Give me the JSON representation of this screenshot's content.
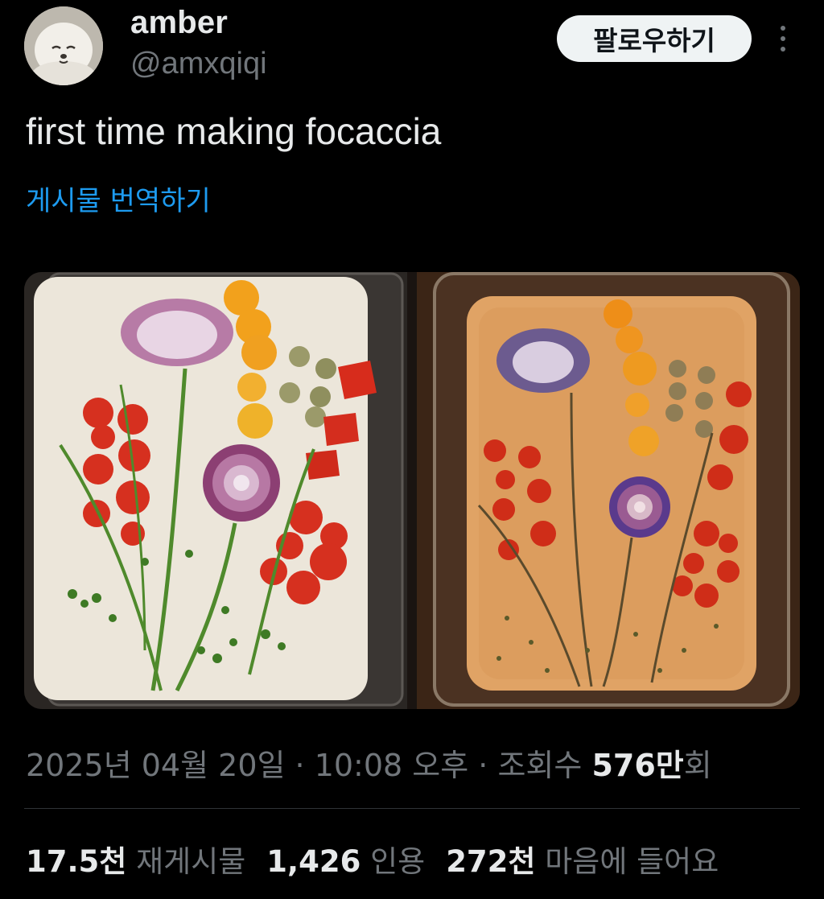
{
  "user": {
    "display_name": "amber",
    "handle": "@amxqiqi",
    "follow_label": "팔로우하기"
  },
  "tweet": {
    "text": "first time making focaccia",
    "translate_label": "게시물 번역하기"
  },
  "meta": {
    "date": "2025년 04월 20일",
    "sep1": " · ",
    "time": "10:08 오후",
    "sep2": " · ",
    "views_label": "조회수 ",
    "views_num": "576만",
    "views_suffix": "회"
  },
  "stats": {
    "reposts_num": "17.5천",
    "reposts_label": "재게시물",
    "quotes_num": "1,426",
    "quotes_label": "인용",
    "likes_num": "272천",
    "likes_label": "마음에 들어요"
  },
  "colors": {
    "background": "#000000",
    "text_primary": "#e7e9ea",
    "text_secondary": "#71767b",
    "link": "#1d9bf0",
    "follow_button_bg": "#eff3f4"
  }
}
